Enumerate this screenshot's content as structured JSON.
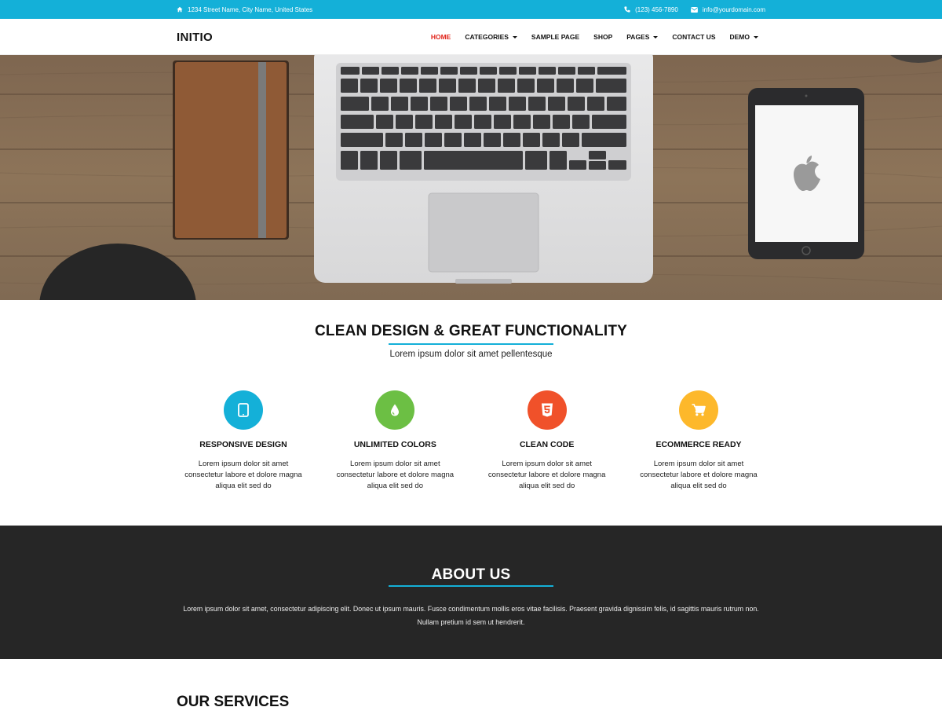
{
  "topbar": {
    "address": "1234 Street Name, City Name, United States",
    "phone": "(123) 456-7890",
    "email": "info@yourdomain.com",
    "bg_color": "#14b0d8"
  },
  "header": {
    "logo": "INITIO",
    "nav": [
      {
        "label": "HOME",
        "active": true,
        "dropdown": false
      },
      {
        "label": "CATEGORIES",
        "active": false,
        "dropdown": true
      },
      {
        "label": "SAMPLE PAGE",
        "active": false,
        "dropdown": false
      },
      {
        "label": "SHOP",
        "active": false,
        "dropdown": false
      },
      {
        "label": "PAGES",
        "active": false,
        "dropdown": true
      },
      {
        "label": "CONTACT US",
        "active": false,
        "dropdown": false
      },
      {
        "label": "DEMO",
        "active": false,
        "dropdown": true
      }
    ],
    "active_color": "#e1251b"
  },
  "features": {
    "title": "CLEAN DESIGN & GREAT FUNCTIONALITY",
    "subtitle": "Lorem ipsum dolor sit amet pellentesque",
    "items": [
      {
        "icon": "tablet-icon",
        "color": "#14b0d8",
        "title": "RESPONSIVE DESIGN",
        "desc": "Lorem ipsum dolor sit amet consectetur labore et dolore magna aliqua elit sed do"
      },
      {
        "icon": "droplet-icon",
        "color": "#6cbf44",
        "title": "UNLIMITED COLORS",
        "desc": "Lorem ipsum dolor sit amet consectetur labore et dolore magna aliqua elit sed do"
      },
      {
        "icon": "html5-icon",
        "color": "#f0512a",
        "title": "CLEAN CODE",
        "desc": "Lorem ipsum dolor sit amet consectetur labore et dolore magna aliqua elit sed do"
      },
      {
        "icon": "cart-icon",
        "color": "#fdb82b",
        "title": "ECOMMERCE READY",
        "desc": "Lorem ipsum dolor sit amet consectetur labore et dolore magna aliqua elit sed do"
      }
    ]
  },
  "about": {
    "title": "ABOUT US",
    "text": "Lorem ipsum dolor sit amet, consectetur adipiscing elit. Donec ut ipsum mauris. Fusce condimentum mollis eros vitae facilisis. Praesent gravida dignissim felis, id sagittis mauris rutrum non. Nullam pretium id sem ut hendrerit."
  },
  "services": {
    "title": "OUR SERVICES"
  }
}
